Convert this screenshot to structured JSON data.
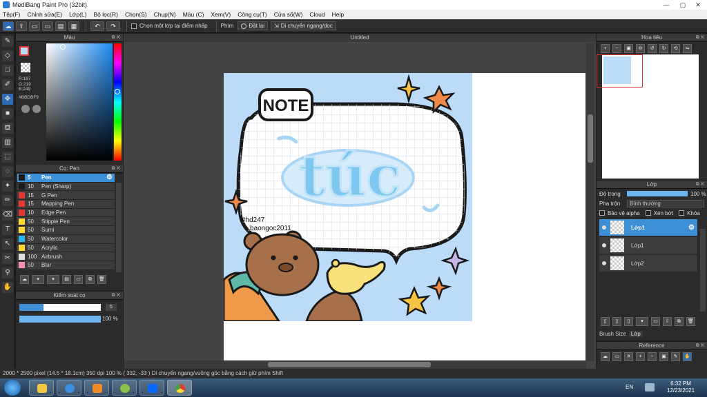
{
  "window": {
    "title": "MediBang Paint Pro (32bit)",
    "min": "—",
    "max": "▢",
    "close": "✕"
  },
  "menu": [
    "Tệp(F)",
    "Chỉnh sửa(E)",
    "Lớp(L)",
    "Bộ lọc(R)",
    "Chọn(S)",
    "Chụp(N)",
    "Màu (C)",
    "Xem(V)",
    "Công cụ(T)",
    "Cửa sổ(W)",
    "Cloud",
    "Help"
  ],
  "toolbar": {
    "select_layer_label": "Chọn một lớp tại điểm nhấp",
    "phim_label": "Phím",
    "reset_label": "Đặt lại",
    "move_hv_label": "Di chuyển ngang/dọc",
    "undo": "↶",
    "redo": "↷"
  },
  "color_panel": {
    "title": "Màu",
    "r": "R:187",
    "g": "G:219",
    "b": "B:249",
    "hex": "#BBDBF9"
  },
  "brush_panel": {
    "title": "Cọ: Pen",
    "items": [
      {
        "size": "5",
        "name": "Pen",
        "color": "#1a1a1a"
      },
      {
        "size": "10",
        "name": "Pen (Sharp)",
        "color": "#1a1a1a"
      },
      {
        "size": "15",
        "name": "G Pen",
        "color": "#e53935"
      },
      {
        "size": "15",
        "name": "Mapping Pen",
        "color": "#e53935"
      },
      {
        "size": "10",
        "name": "Edge Pen",
        "color": "#e53935"
      },
      {
        "size": "50",
        "name": "Stipple Pen",
        "color": "#fdd835"
      },
      {
        "size": "50",
        "name": "Sumi",
        "color": "#fdd835"
      },
      {
        "size": "50",
        "name": "Watercolor",
        "color": "#29b6f6"
      },
      {
        "size": "50",
        "name": "Acrylic",
        "color": "#fdd835"
      },
      {
        "size": "100",
        "name": "Airbrush",
        "color": "#e0e0e0"
      },
      {
        "size": "50",
        "name": "Blur",
        "color": "#f48fb1"
      }
    ],
    "selected": 0
  },
  "control_panel": {
    "title": "Kiểm soát cọ",
    "size_value": "5",
    "opacity_value": "100 %",
    "size_fraction": 0.3,
    "opacity_fraction": 1.0
  },
  "document": {
    "tab": "Untitled"
  },
  "artwork": {
    "heading": "NOTE",
    "bubble_text": "túc",
    "watermark_line1": "#hd247",
    "watermark_line2": "baongoc2011"
  },
  "navigator": {
    "title": "Hoa tiêu"
  },
  "layer_panel": {
    "title": "Lớp",
    "opacity_label": "Độ trong",
    "opacity_value": "100 %",
    "blend_label": "Pha trộn",
    "blend_value": "Bình thường",
    "protect_alpha": "Bảo vệ alpha",
    "clip": "Xén bớt",
    "lock": "Khóa",
    "layers": [
      {
        "name": "Lớp1",
        "selected": true
      },
      {
        "name": "Lớp1",
        "selected": false
      },
      {
        "name": "Lớp2",
        "selected": false
      }
    ],
    "tabs": [
      "Brush Size",
      "Lớp"
    ]
  },
  "reference_panel": {
    "title": "Reference"
  },
  "statusbar": {
    "text": "2000 * 2500 pixel   (14.5 * 18.1cm)   350 dpi   100 %   ( 332, -33 )   Di chuyển ngang/vuông góc bằng cách giữ phím Shift"
  },
  "taskbar": {
    "lang": "EN",
    "time": "6:32 PM",
    "date": "12/23/2021"
  },
  "colors": {
    "accent": "#3d8fd6",
    "canvas_bg": "#bbdbf9",
    "panel": "#2b2b2b"
  }
}
